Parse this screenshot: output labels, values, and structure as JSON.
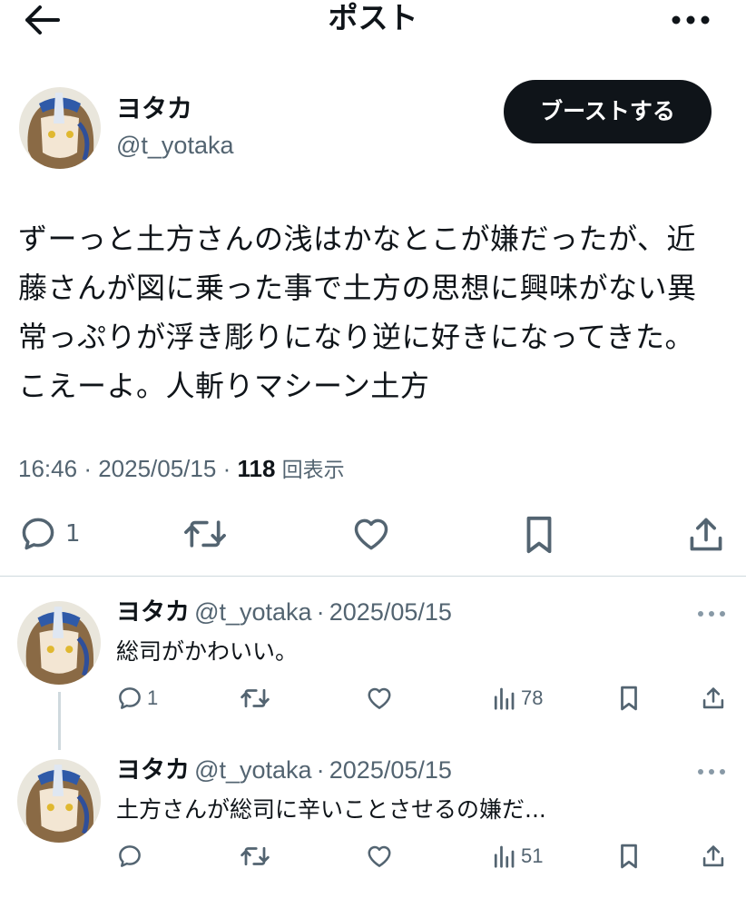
{
  "header": {
    "title": "ポスト",
    "back_icon": "arrow-left-icon",
    "more_icon": "more-horizontal-icon"
  },
  "author": {
    "name": "ヨタカ",
    "handle": "@t_yotaka",
    "boost_label": "ブーストする"
  },
  "post": {
    "lines": [
      "ずーっと土方さんの浅はかなとこが嫌だったが、近",
      "藤さんが図に乗った事で土方の思想に興味がない異",
      "常っぷりが浮き彫りになり逆に好きになってきた。",
      "こえーよ。人斬りマシーン土方"
    ],
    "time": "16:46",
    "date": "2025/05/15",
    "views": "118",
    "views_label": "回表示"
  },
  "actions": {
    "reply_count": "1"
  },
  "replies": [
    {
      "name": "ヨタカ",
      "handle": "@t_yotaka",
      "date": "2025/05/15",
      "text": "総司がかわいい。",
      "reply_count": "1",
      "views": "78"
    },
    {
      "name": "ヨタカ",
      "handle": "@t_yotaka",
      "date": "2025/05/15",
      "text": "土方さんが総司に辛いことさせるの嫌だ...",
      "reply_count": "",
      "views": "51"
    }
  ],
  "colors": {
    "text": "#0f1419",
    "secondary": "#536471",
    "divider": "#cfd9de",
    "button": "#0f1419"
  }
}
